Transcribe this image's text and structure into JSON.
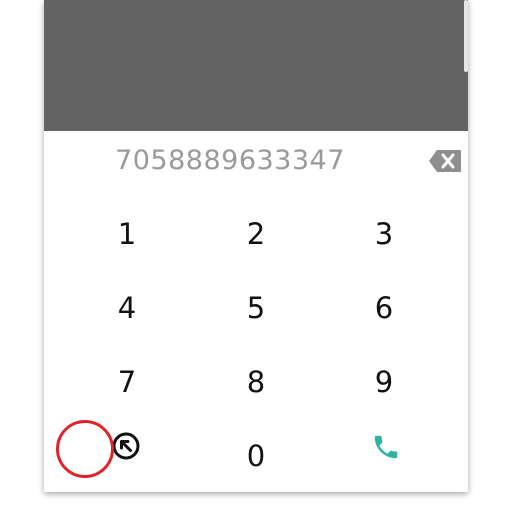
{
  "dialer": {
    "number": "7058889633347",
    "keys": [
      "1",
      "2",
      "3",
      "4",
      "5",
      "6",
      "7",
      "8",
      "9",
      "0"
    ]
  },
  "icons": {
    "backspace": "backspace-icon",
    "minimize": "arrow-up-left-icon",
    "call": "phone-icon"
  },
  "colors": {
    "top_area": "#636363",
    "number_text": "#9a9a9a",
    "call_icon": "#2bb5a0",
    "highlight_ring": "#e0242a"
  }
}
